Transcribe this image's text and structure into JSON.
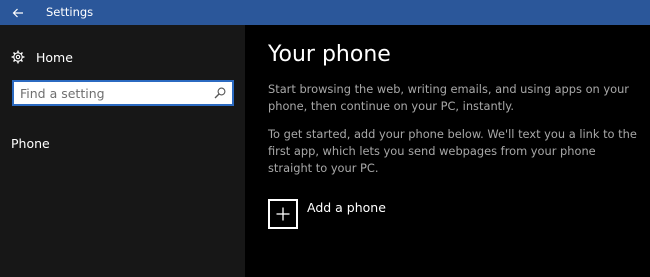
{
  "titlebar": {
    "title": "Settings",
    "back_icon": "back-arrow-icon",
    "color": "#2b579a"
  },
  "sidebar": {
    "home_icon": "gear-icon",
    "home_label": "Home",
    "search": {
      "placeholder": "Find a setting",
      "value": "",
      "icon": "search-icon"
    },
    "items": [
      {
        "label": "Phone"
      }
    ]
  },
  "main": {
    "title": "Your phone",
    "paragraph1": "Start browsing the web, writing emails, and using apps on your phone, then continue on your PC, instantly.",
    "paragraph2": "To get started, add your phone below. We'll text you a link to the first app, which lets you send webpages from your phone straight to your PC.",
    "add_phone": {
      "label": "Add a phone",
      "icon": "plus-icon"
    }
  },
  "colors": {
    "accent": "#2b579a",
    "search_border": "#2b6ac1",
    "sidebar_bg": "#171717",
    "main_bg": "#000000",
    "body_text": "#a8a8a8"
  }
}
